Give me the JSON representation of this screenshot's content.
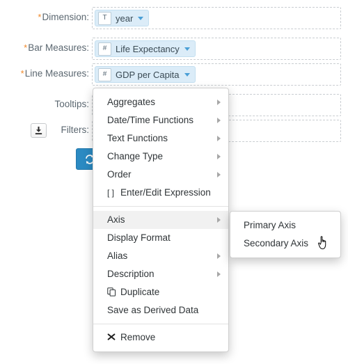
{
  "form": {
    "rows": [
      {
        "label": "Dimension:",
        "required": true,
        "has_icon": false,
        "tag": {
          "type_badge": "T",
          "label": "year",
          "caret": "chevron-down-icon"
        }
      },
      {
        "label": "Bar Measures:",
        "required": true,
        "has_icon": false,
        "tag": {
          "type_badge": "#",
          "label": "Life Expectancy",
          "caret": "chevron-down-icon"
        }
      },
      {
        "label": "Line Measures:",
        "required": true,
        "has_icon": false,
        "tag": {
          "type_badge": "#",
          "label": "GDP per Capita",
          "caret": "chevron-down-icon"
        }
      },
      {
        "label": "Tooltips:",
        "required": false,
        "has_icon": false,
        "tag": null
      },
      {
        "label": "Filters:",
        "required": false,
        "has_icon": true,
        "icon_name": "import-filter-icon",
        "tag": null
      }
    ],
    "refresh_button": {
      "icon": "refresh-icon"
    }
  },
  "context_menu": {
    "items": [
      {
        "label": "Aggregates",
        "submenu": true,
        "icon": null,
        "separator_after": false,
        "active": false
      },
      {
        "label": "Date/Time Functions",
        "submenu": true,
        "icon": null,
        "separator_after": false,
        "active": false
      },
      {
        "label": "Text Functions",
        "submenu": true,
        "icon": null,
        "separator_after": false,
        "active": false
      },
      {
        "label": "Change Type",
        "submenu": true,
        "icon": null,
        "separator_after": false,
        "active": false
      },
      {
        "label": "Order",
        "submenu": true,
        "icon": null,
        "separator_after": false,
        "active": false
      },
      {
        "label": "Enter/Edit Expression",
        "submenu": false,
        "icon": "[ ]",
        "separator_after": true,
        "active": false
      },
      {
        "label": "Axis",
        "submenu": true,
        "icon": null,
        "separator_after": false,
        "active": true
      },
      {
        "label": "Display Format",
        "submenu": false,
        "icon": null,
        "separator_after": false,
        "active": false
      },
      {
        "label": "Alias",
        "submenu": true,
        "icon": null,
        "separator_after": false,
        "active": false
      },
      {
        "label": "Description",
        "submenu": true,
        "icon": null,
        "separator_after": false,
        "active": false
      },
      {
        "label": "Duplicate",
        "submenu": false,
        "icon": "duplicate-icon",
        "separator_after": false,
        "active": false
      },
      {
        "label": "Save as Derived Data",
        "submenu": false,
        "icon": null,
        "separator_after": true,
        "active": false
      },
      {
        "label": "Remove",
        "submenu": false,
        "icon": "remove-icon",
        "separator_after": false,
        "active": false
      }
    ]
  },
  "axis_submenu": {
    "items": [
      {
        "label": "Primary Axis",
        "active": false
      },
      {
        "label": "Secondary Axis",
        "active": true
      }
    ]
  },
  "colors": {
    "tag_background": "#dbecf8",
    "tag_border": "#c3dff0",
    "required_asterisk": "#f0892a",
    "refresh_button": "#2b8ac2",
    "menu_highlight": "#f1f1f1",
    "dropzone_border": "#c9cdd1"
  },
  "cursor": {
    "name": "pointer-hand-cursor"
  }
}
